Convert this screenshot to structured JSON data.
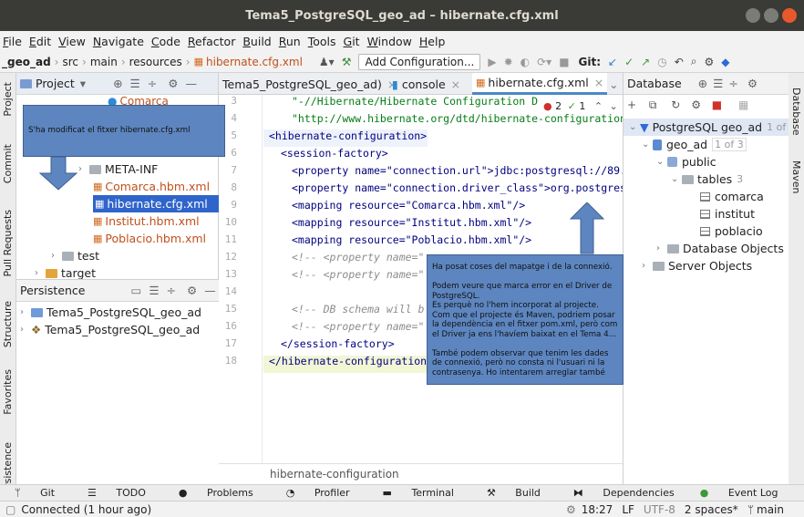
{
  "window": {
    "title": "Tema5_PostgreSQL_geo_ad – hibernate.cfg.xml"
  },
  "menu": [
    "File",
    "Edit",
    "View",
    "Navigate",
    "Code",
    "Refactor",
    "Build",
    "Run",
    "Tools",
    "Git",
    "Window",
    "Help"
  ],
  "breadcrumb": {
    "project": "_geo_ad",
    "src": "src",
    "main": "main",
    "resources": "resources",
    "file": "hibernate.cfg.xml"
  },
  "toolbar": {
    "add_config": "Add Configuration...",
    "git_label": "Git:"
  },
  "left_strip": {
    "project": "Project",
    "commit": "Commit",
    "pull_requests": "Pull Requests",
    "structure": "Structure",
    "favorites": "Favorites",
    "persistence": "rsistence"
  },
  "project_panel": {
    "title": "Project",
    "partial_item": "Comarca",
    "items": [
      "META-INF",
      "Comarca.hbm.xml",
      "hibernate.cfg.xml",
      "Institut.hbm.xml",
      "Poblacio.hbm.xml",
      "test",
      "target"
    ]
  },
  "persistence_panel": {
    "title": "Persistence",
    "items": [
      "Tema5_PostgreSQL_geo_ad",
      "Tema5_PostgreSQL_geo_ad"
    ]
  },
  "editor_tabs": [
    "Tema5_PostgreSQL_geo_ad)",
    "console",
    "hibernate.cfg.xml"
  ],
  "inspections": {
    "errors": "2",
    "warnings": "1"
  },
  "code_lines": [
    {
      "n": "3",
      "text": "\"-//Hibernate/Hibernate Configuration D"
    },
    {
      "n": "4",
      "text": "\"http://www.hibernate.org/dtd/hibernate-configuration"
    },
    {
      "n": "5",
      "text": "<hibernate-configuration>"
    },
    {
      "n": "6",
      "text": "<session-factory>"
    },
    {
      "n": "7",
      "text": "<property name=\"connection.url\">jdbc:postgresql://89."
    },
    {
      "n": "8",
      "text": "<property name=\"connection.driver_class\">org.postgres"
    },
    {
      "n": "9",
      "text": "<mapping resource=\"Comarca.hbm.xml\"/>"
    },
    {
      "n": "10",
      "text": "<mapping resource=\"Institut.hbm.xml\"/>"
    },
    {
      "n": "11",
      "text": "<mapping resource=\"Poblacio.hbm.xml\"/>"
    },
    {
      "n": "12",
      "text": "<!-- <property name=\""
    },
    {
      "n": "13",
      "text": "<!-- <property name=\""
    },
    {
      "n": "14",
      "text": ""
    },
    {
      "n": "15",
      "text": "<!-- DB schema will b"
    },
    {
      "n": "16",
      "text": "<!-- <property name=\""
    },
    {
      "n": "17",
      "text": "</session-factory>"
    },
    {
      "n": "18",
      "text": "</hibernate-configuration>"
    }
  ],
  "editor_breadcrumb": "hibernate-configuration",
  "database_panel": {
    "title": "Database",
    "datasource": "PostgreSQL geo_ad",
    "datasource_hint": "1 of",
    "db": "geo_ad",
    "db_hint": "1 of 3",
    "schema": "public",
    "tables_label": "tables",
    "tables_count": "3",
    "tables": [
      "comarca",
      "institut",
      "poblacio"
    ],
    "db_objects": "Database Objects",
    "server_objects": "Server Objects"
  },
  "right_strip": {
    "database": "Database",
    "maven": "Maven"
  },
  "bottom_tools": [
    "Git",
    "TODO",
    "Problems",
    "Profiler",
    "Terminal",
    "Build",
    "Dependencies",
    "Event Log"
  ],
  "status": {
    "connected": "Connected (1 hour ago)",
    "time": "18:27",
    "line_sep": "LF",
    "encoding": "UTF-8",
    "indent": "2 spaces*",
    "branch": "main"
  },
  "notes": {
    "top": "S'ha modificat el fitxer hibernate.cfg.xml",
    "right": "Ha posat coses del mapatge i de la connexió.\n\nPodem veure que marca error en el Driver de PostgreSQL.\nEs perquè no l'hem incorporat al projecte.\nCom que el projecte és Maven, podriem posar la dependència en el fitxer pom.xml, però com el Driver ja ens l'havíem baixat en el Tema 4...\n\nTambé podem observar que tenim les dades de connexió, però no consta ni l'usuari ni la contrasenya. Ho intentarem arreglar també"
  }
}
